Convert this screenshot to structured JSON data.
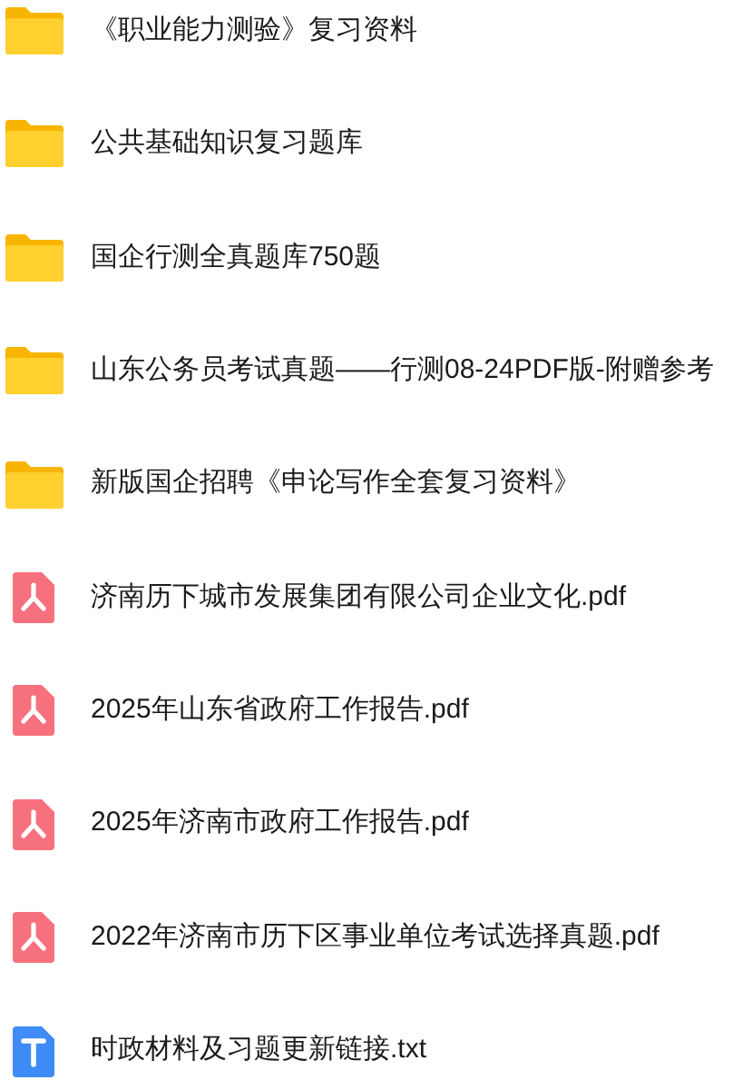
{
  "files": [
    {
      "kind": "folder",
      "name": "《职业能力测验》复习资料"
    },
    {
      "kind": "folder",
      "name": "公共基础知识复习题库"
    },
    {
      "kind": "folder",
      "name": "国企行测全真题库750题"
    },
    {
      "kind": "folder",
      "name": "山东公务员考试真题——行测08-24PDF版-附赠参考"
    },
    {
      "kind": "folder",
      "name": "新版国企招聘《申论写作全套复习资料》"
    },
    {
      "kind": "pdf",
      "name": "济南历下城市发展集团有限公司企业文化.pdf"
    },
    {
      "kind": "pdf",
      "name": "2025年山东省政府工作报告.pdf"
    },
    {
      "kind": "pdf",
      "name": "2025年济南市政府工作报告.pdf"
    },
    {
      "kind": "pdf",
      "name": "2022年济南市历下区事业单位考试选择真题.pdf"
    },
    {
      "kind": "txt",
      "name": "时政材料及习题更新链接.txt"
    }
  ]
}
